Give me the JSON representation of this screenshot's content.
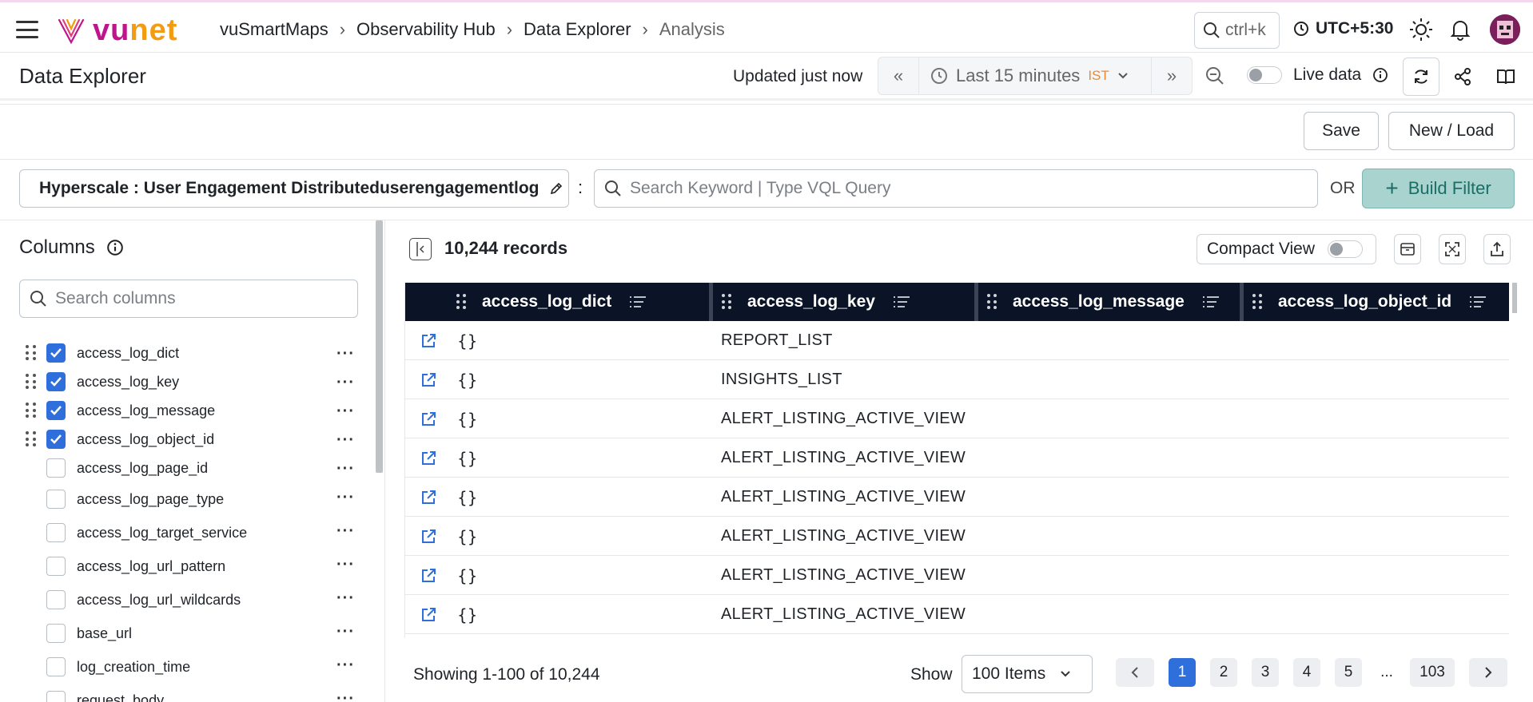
{
  "header": {
    "logo_text_a": "vu",
    "logo_text_b": "net",
    "breadcrumbs": [
      "vuSmartMaps",
      "Observability Hub",
      "Data Explorer",
      "Analysis"
    ],
    "search_shortcut": "ctrl+k",
    "timezone": "UTC+5:30"
  },
  "titlebar": {
    "title": "Data Explorer",
    "updated": "Updated just now",
    "time_range": "Last 15 minutes",
    "tz_badge": "IST",
    "live_label": "Live data"
  },
  "toolbar": {
    "save": "Save",
    "new_load": "New / Load"
  },
  "filter": {
    "source": "Hyperscale : User Engagement Distributeduserengagementlog",
    "colon": ":",
    "query_placeholder": "Search Keyword | Type VQL Query",
    "or": "OR",
    "build_filter": "Build Filter"
  },
  "sidebar": {
    "title": "Columns",
    "search_placeholder": "Search columns",
    "columns": [
      {
        "name": "access_log_dict",
        "checked": true
      },
      {
        "name": "access_log_key",
        "checked": true
      },
      {
        "name": "access_log_message",
        "checked": true
      },
      {
        "name": "access_log_object_id",
        "checked": true
      },
      {
        "name": "access_log_page_id",
        "checked": false
      },
      {
        "name": "access_log_page_type",
        "checked": false
      },
      {
        "name": "access_log_target_service",
        "checked": false
      },
      {
        "name": "access_log_url_pattern",
        "checked": false
      },
      {
        "name": "access_log_url_wildcards",
        "checked": false
      },
      {
        "name": "base_url",
        "checked": false
      },
      {
        "name": "log_creation_time",
        "checked": false
      },
      {
        "name": "request_body",
        "checked": false
      }
    ]
  },
  "table": {
    "records": "10,244 records",
    "compact_view": "Compact View",
    "headers": [
      "access_log_dict",
      "access_log_key",
      "access_log_message",
      "access_log_object_id"
    ],
    "rows": [
      {
        "dict": "{}",
        "key": "REPORT_LIST"
      },
      {
        "dict": "{}",
        "key": "INSIGHTS_LIST"
      },
      {
        "dict": "{}",
        "key": "ALERT_LISTING_ACTIVE_VIEW"
      },
      {
        "dict": "{}",
        "key": "ALERT_LISTING_ACTIVE_VIEW"
      },
      {
        "dict": "{}",
        "key": "ALERT_LISTING_ACTIVE_VIEW"
      },
      {
        "dict": "{}",
        "key": "ALERT_LISTING_ACTIVE_VIEW"
      },
      {
        "dict": "{}",
        "key": "ALERT_LISTING_ACTIVE_VIEW"
      },
      {
        "dict": "{}",
        "key": "ALERT_LISTING_ACTIVE_VIEW"
      }
    ]
  },
  "footer": {
    "showing": "Showing 1-100 of 10,244",
    "show_label": "Show",
    "page_size": "100 Items",
    "pages": [
      "1",
      "2",
      "3",
      "4",
      "5"
    ],
    "ellipsis": "...",
    "last_page": "103"
  },
  "colors": {
    "brand": "#c0148c",
    "brand_accent": "#f39c12",
    "primary": "#2f6fdb",
    "header_bg": "#0b1426",
    "build_bg": "#a9d3cf"
  },
  "icons": [
    "menu-icon",
    "search-icon",
    "clock-icon",
    "sun-icon",
    "bell-icon",
    "refresh-icon",
    "share-icon",
    "book-icon",
    "pencil-icon",
    "plus-icon",
    "info-icon",
    "drag-handle-icon",
    "open-link-icon",
    "column-menu-icon",
    "export-icon",
    "fullscreen-icon",
    "archive-icon",
    "chevron-down-icon"
  ]
}
